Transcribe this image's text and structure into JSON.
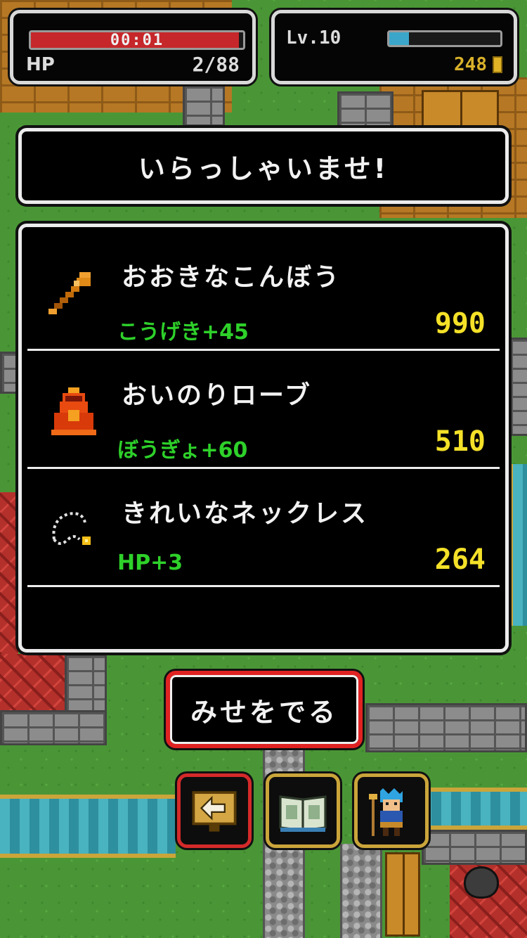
{
  "hud": {
    "timer": "00:01",
    "hp_label": "HP",
    "hp_value": "2/88",
    "hp_fraction": 0.98,
    "level_label": "Lv.10",
    "xp_fraction": 0.18,
    "gold": "248",
    "colors": {
      "hp": "#c6272a",
      "xp": "#3ba6c9",
      "gold": "#d8b12a"
    }
  },
  "shop": {
    "greeting": "いらっしゃいませ!",
    "items": [
      {
        "name": "おおきなこんぼう",
        "stat": "こうげき+45",
        "price": "990",
        "icon": "club-icon"
      },
      {
        "name": "おいのりローブ",
        "stat": "ぼうぎょ+60",
        "price": "510",
        "icon": "robe-icon"
      },
      {
        "name": "きれいなネックレス",
        "stat": "HP+3",
        "price": "264",
        "icon": "necklace-icon"
      }
    ],
    "exit_label": "みせをでる",
    "colors": {
      "stat": "#2ed12a",
      "price": "#f4e128"
    }
  },
  "toolbar": {
    "buttons": [
      {
        "icon": "back-arrow-icon"
      },
      {
        "icon": "book-icon"
      },
      {
        "icon": "hero-icon"
      }
    ]
  }
}
